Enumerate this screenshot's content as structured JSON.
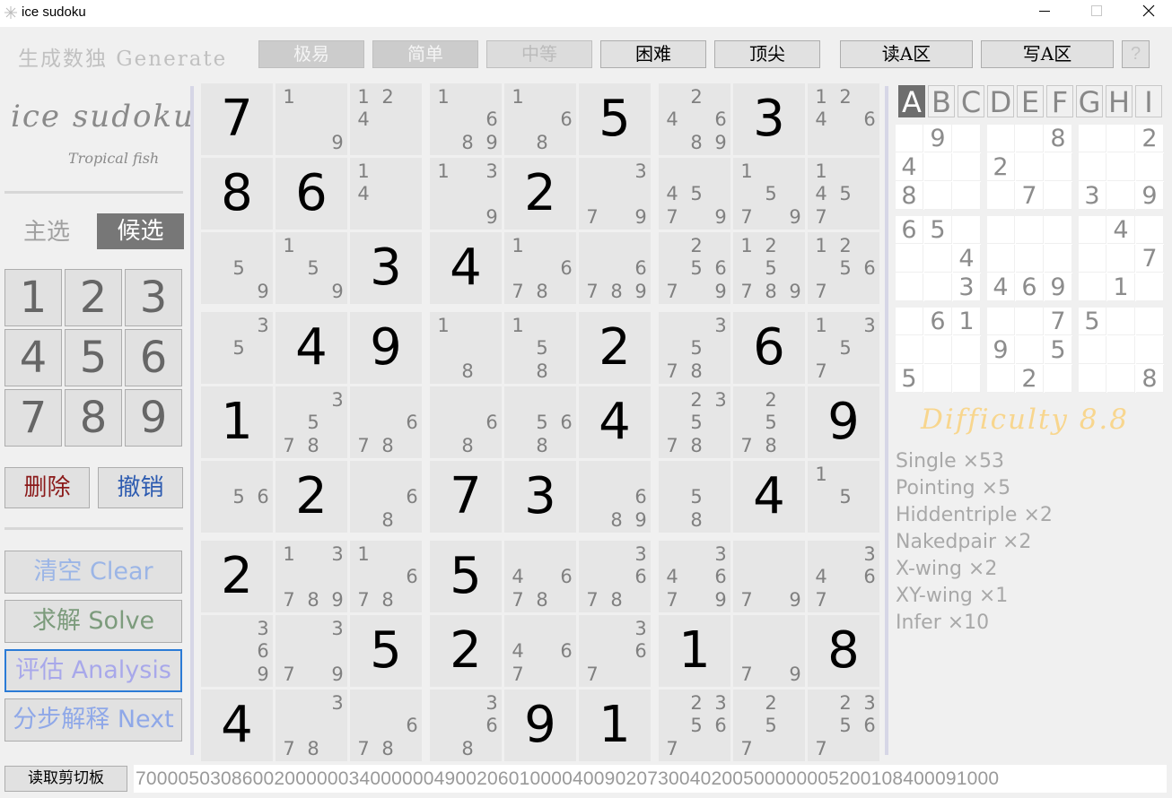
{
  "window": {
    "title": "ice sudoku"
  },
  "toolbar": {
    "generate_label": "生成数独 Generate",
    "levels": [
      "极易",
      "简单",
      "中等",
      "困难",
      "顶尖"
    ],
    "read_a": "读A区",
    "write_a": "写A区",
    "help": "?"
  },
  "logo": {
    "title": "ice sudoku",
    "subtitle": "Tropical fish"
  },
  "mode_tabs": {
    "main": "主选",
    "candidate": "候选"
  },
  "numpad": [
    "1",
    "2",
    "3",
    "4",
    "5",
    "6",
    "7",
    "8",
    "9"
  ],
  "actions": {
    "delete": "删除",
    "undo": "撤销"
  },
  "big_buttons": {
    "clear": "清空 Clear",
    "solve": "求解 Solve",
    "analysis": "评估 Analysis",
    "next": "分步解释 Next"
  },
  "colors": {
    "delete": "#8b1a1a",
    "undo": "#2d5bb0",
    "clear": "#9bb5e6",
    "solve": "#7c9b7c",
    "analysis": "#a8a8ea",
    "next": "#8fa8e8",
    "difficulty": "#f8d68e",
    "focus_border": "#2b7bd6"
  },
  "board": [
    [
      "7",
      "19",
      "124",
      "1689",
      "168",
      "5",
      "24689",
      "3",
      "1246"
    ],
    [
      "8",
      "6",
      "14",
      "139",
      "2",
      "379",
      "4579",
      "1579",
      "1457"
    ],
    [
      "59",
      "159",
      "3",
      "4",
      "1678",
      "6789",
      "25679",
      "125789",
      "12567"
    ],
    [
      "35",
      "4",
      "9",
      "18",
      "158",
      "2",
      "3578",
      "6",
      "1357"
    ],
    [
      "1",
      "3578",
      "678",
      "68",
      "568",
      "4",
      "23578",
      "2578",
      "9"
    ],
    [
      "56",
      "2",
      "68",
      "7",
      "3",
      "689",
      "58",
      "4",
      "15"
    ],
    [
      "2",
      "13789",
      "1678",
      "5",
      "4678",
      "3678",
      "34679",
      "79",
      "3467"
    ],
    [
      "369",
      "379",
      "5",
      "2",
      "467",
      "367",
      "1",
      "79",
      "8"
    ],
    [
      "4",
      "378",
      "678",
      "368",
      "9",
      "1",
      "23567",
      "257",
      "23567"
    ]
  ],
  "givens_mask": [
    [
      1,
      0,
      0,
      0,
      0,
      1,
      0,
      1,
      0
    ],
    [
      1,
      1,
      0,
      0,
      1,
      0,
      0,
      0,
      0
    ],
    [
      0,
      0,
      1,
      1,
      0,
      0,
      0,
      0,
      0
    ],
    [
      0,
      1,
      1,
      0,
      0,
      1,
      0,
      1,
      0
    ],
    [
      1,
      0,
      0,
      0,
      0,
      1,
      0,
      0,
      1
    ],
    [
      0,
      1,
      0,
      1,
      1,
      0,
      0,
      1,
      0
    ],
    [
      1,
      0,
      0,
      1,
      0,
      0,
      0,
      0,
      0
    ],
    [
      0,
      0,
      1,
      1,
      0,
      0,
      1,
      0,
      1
    ],
    [
      1,
      0,
      0,
      0,
      1,
      1,
      0,
      0,
      0
    ]
  ],
  "templates": [
    "A",
    "B",
    "C",
    "D",
    "E",
    "F",
    "G",
    "H",
    "I"
  ],
  "active_template": "A",
  "mini_grid": [
    [
      "",
      "9",
      "",
      "",
      "",
      "8",
      "",
      "",
      "2"
    ],
    [
      "4",
      "",
      "",
      "2",
      "",
      "",
      "",
      "",
      ""
    ],
    [
      "8",
      "",
      "",
      "",
      "7",
      "",
      "3",
      "",
      "9"
    ],
    [
      "6",
      "5",
      "",
      "",
      "",
      "",
      "",
      "4",
      ""
    ],
    [
      "",
      "",
      "4",
      "",
      "",
      "",
      "",
      "",
      "7"
    ],
    [
      "",
      "",
      "3",
      "4",
      "6",
      "9",
      "",
      "1",
      ""
    ],
    [
      "",
      "6",
      "1",
      "",
      "",
      "7",
      "5",
      "",
      ""
    ],
    [
      "",
      "",
      "",
      "9",
      "",
      "5",
      "",
      "",
      ""
    ],
    [
      "5",
      "",
      "",
      "",
      "2",
      "",
      "",
      "",
      "8"
    ]
  ],
  "difficulty": "Difficulty 8.8",
  "techniques": [
    "Single ×53",
    "Pointing  ×5",
    "Hiddentriple  ×2",
    "Nakedpair  ×2",
    "X-wing  ×2",
    "XY-wing  ×1",
    "Infer  ×10"
  ],
  "clipboard_button": "读取剪切板",
  "puzzle_string": "700005030860020000003400000049002060100004009020730040200500000005200108400091000"
}
